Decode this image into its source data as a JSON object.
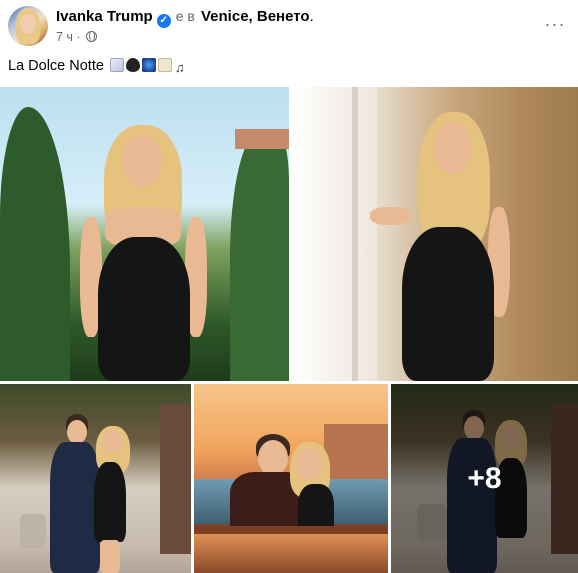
{
  "post": {
    "author": "Ivanka Trump",
    "in_text": "е в",
    "location": "Venice, Венето",
    "end_dot": ".",
    "time": "7 ч ·",
    "caption": "La Dolce Notte",
    "caption_emojis": [
      "envelope-emoji",
      "black-heart-emoji",
      "night-sky-emoji",
      "scroll-emoji",
      "musical-notes-emoji"
    ],
    "more_menu": "···"
  },
  "photos": {
    "extra_count_label": "+8"
  },
  "colors": {
    "verified": "#1877f2",
    "secondary_text": "#65676b"
  }
}
